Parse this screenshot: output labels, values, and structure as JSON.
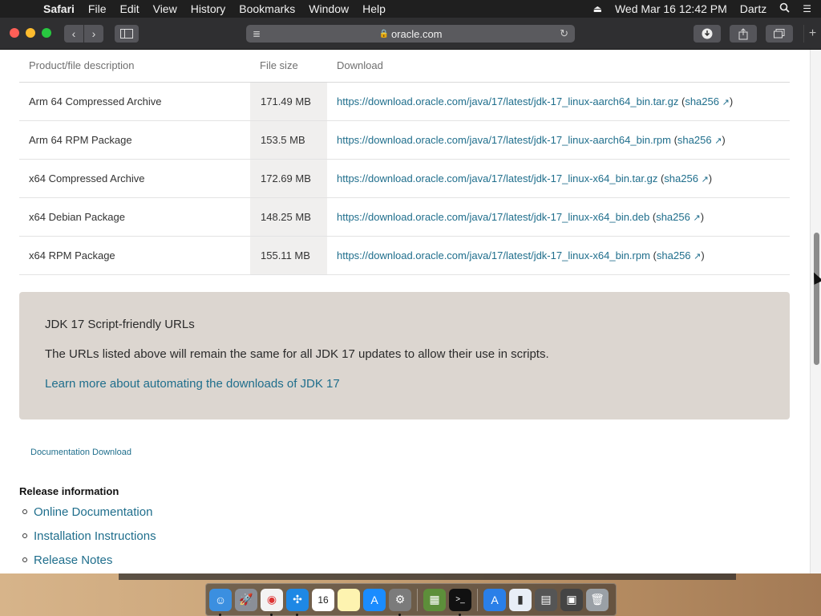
{
  "menubar": {
    "app_name": "Safari",
    "menus": [
      "File",
      "Edit",
      "View",
      "History",
      "Bookmarks",
      "Window",
      "Help"
    ],
    "datetime": "Wed Mar 16  12:42 PM",
    "user": "Dartz"
  },
  "toolbar": {
    "address": "oracle.com"
  },
  "table": {
    "headers": [
      "Product/file description",
      "File size",
      "Download"
    ],
    "rows": [
      {
        "description": "Arm 64 Compressed Archive",
        "size": "171.49 MB",
        "url": "https://download.oracle.com/java/17/latest/jdk-17_linux-aarch64_bin.tar.gz",
        "checksum": "sha256"
      },
      {
        "description": "Arm 64 RPM Package",
        "size": "153.5 MB",
        "url": "https://download.oracle.com/java/17/latest/jdk-17_linux-aarch64_bin.rpm",
        "checksum": "sha256"
      },
      {
        "description": "x64 Compressed Archive",
        "size": "172.69 MB",
        "url": "https://download.oracle.com/java/17/latest/jdk-17_linux-x64_bin.tar.gz",
        "checksum": "sha256"
      },
      {
        "description": "x64 Debian Package",
        "size": "148.25 MB",
        "url": "https://download.oracle.com/java/17/latest/jdk-17_linux-x64_bin.deb",
        "checksum": "sha256"
      },
      {
        "description": "x64 RPM Package",
        "size": "155.11 MB",
        "url": "https://download.oracle.com/java/17/latest/jdk-17_linux-x64_bin.rpm",
        "checksum": "sha256"
      }
    ]
  },
  "callout": {
    "title": "JDK 17 Script-friendly URLs",
    "body": "The URLs listed above will remain the same for all JDK 17 updates to allow their use in scripts.",
    "link": "Learn more about automating the downloads of JDK 17"
  },
  "documentation_link": "Documentation Download",
  "release_info": {
    "heading": "Release information",
    "items": [
      "Online Documentation",
      "Installation Instructions",
      "Release Notes"
    ]
  },
  "dock": {
    "icons": [
      "finder-icon",
      "launchpad-icon",
      "chrome-icon",
      "safari-icon",
      "calendar-icon",
      "notes-icon",
      "app-store-icon",
      "system-preferences-icon",
      "minecraft-icon",
      "terminal-icon",
      "app-store-folder-icon",
      "documents-icon",
      "downloads-icon",
      "screenshots-icon",
      "trash-icon"
    ],
    "calendar_day": "16"
  },
  "colors": {
    "link": "#1f6e8c",
    "callout_bg": "#dcd6d0",
    "size_column_bg": "#f0efee"
  }
}
